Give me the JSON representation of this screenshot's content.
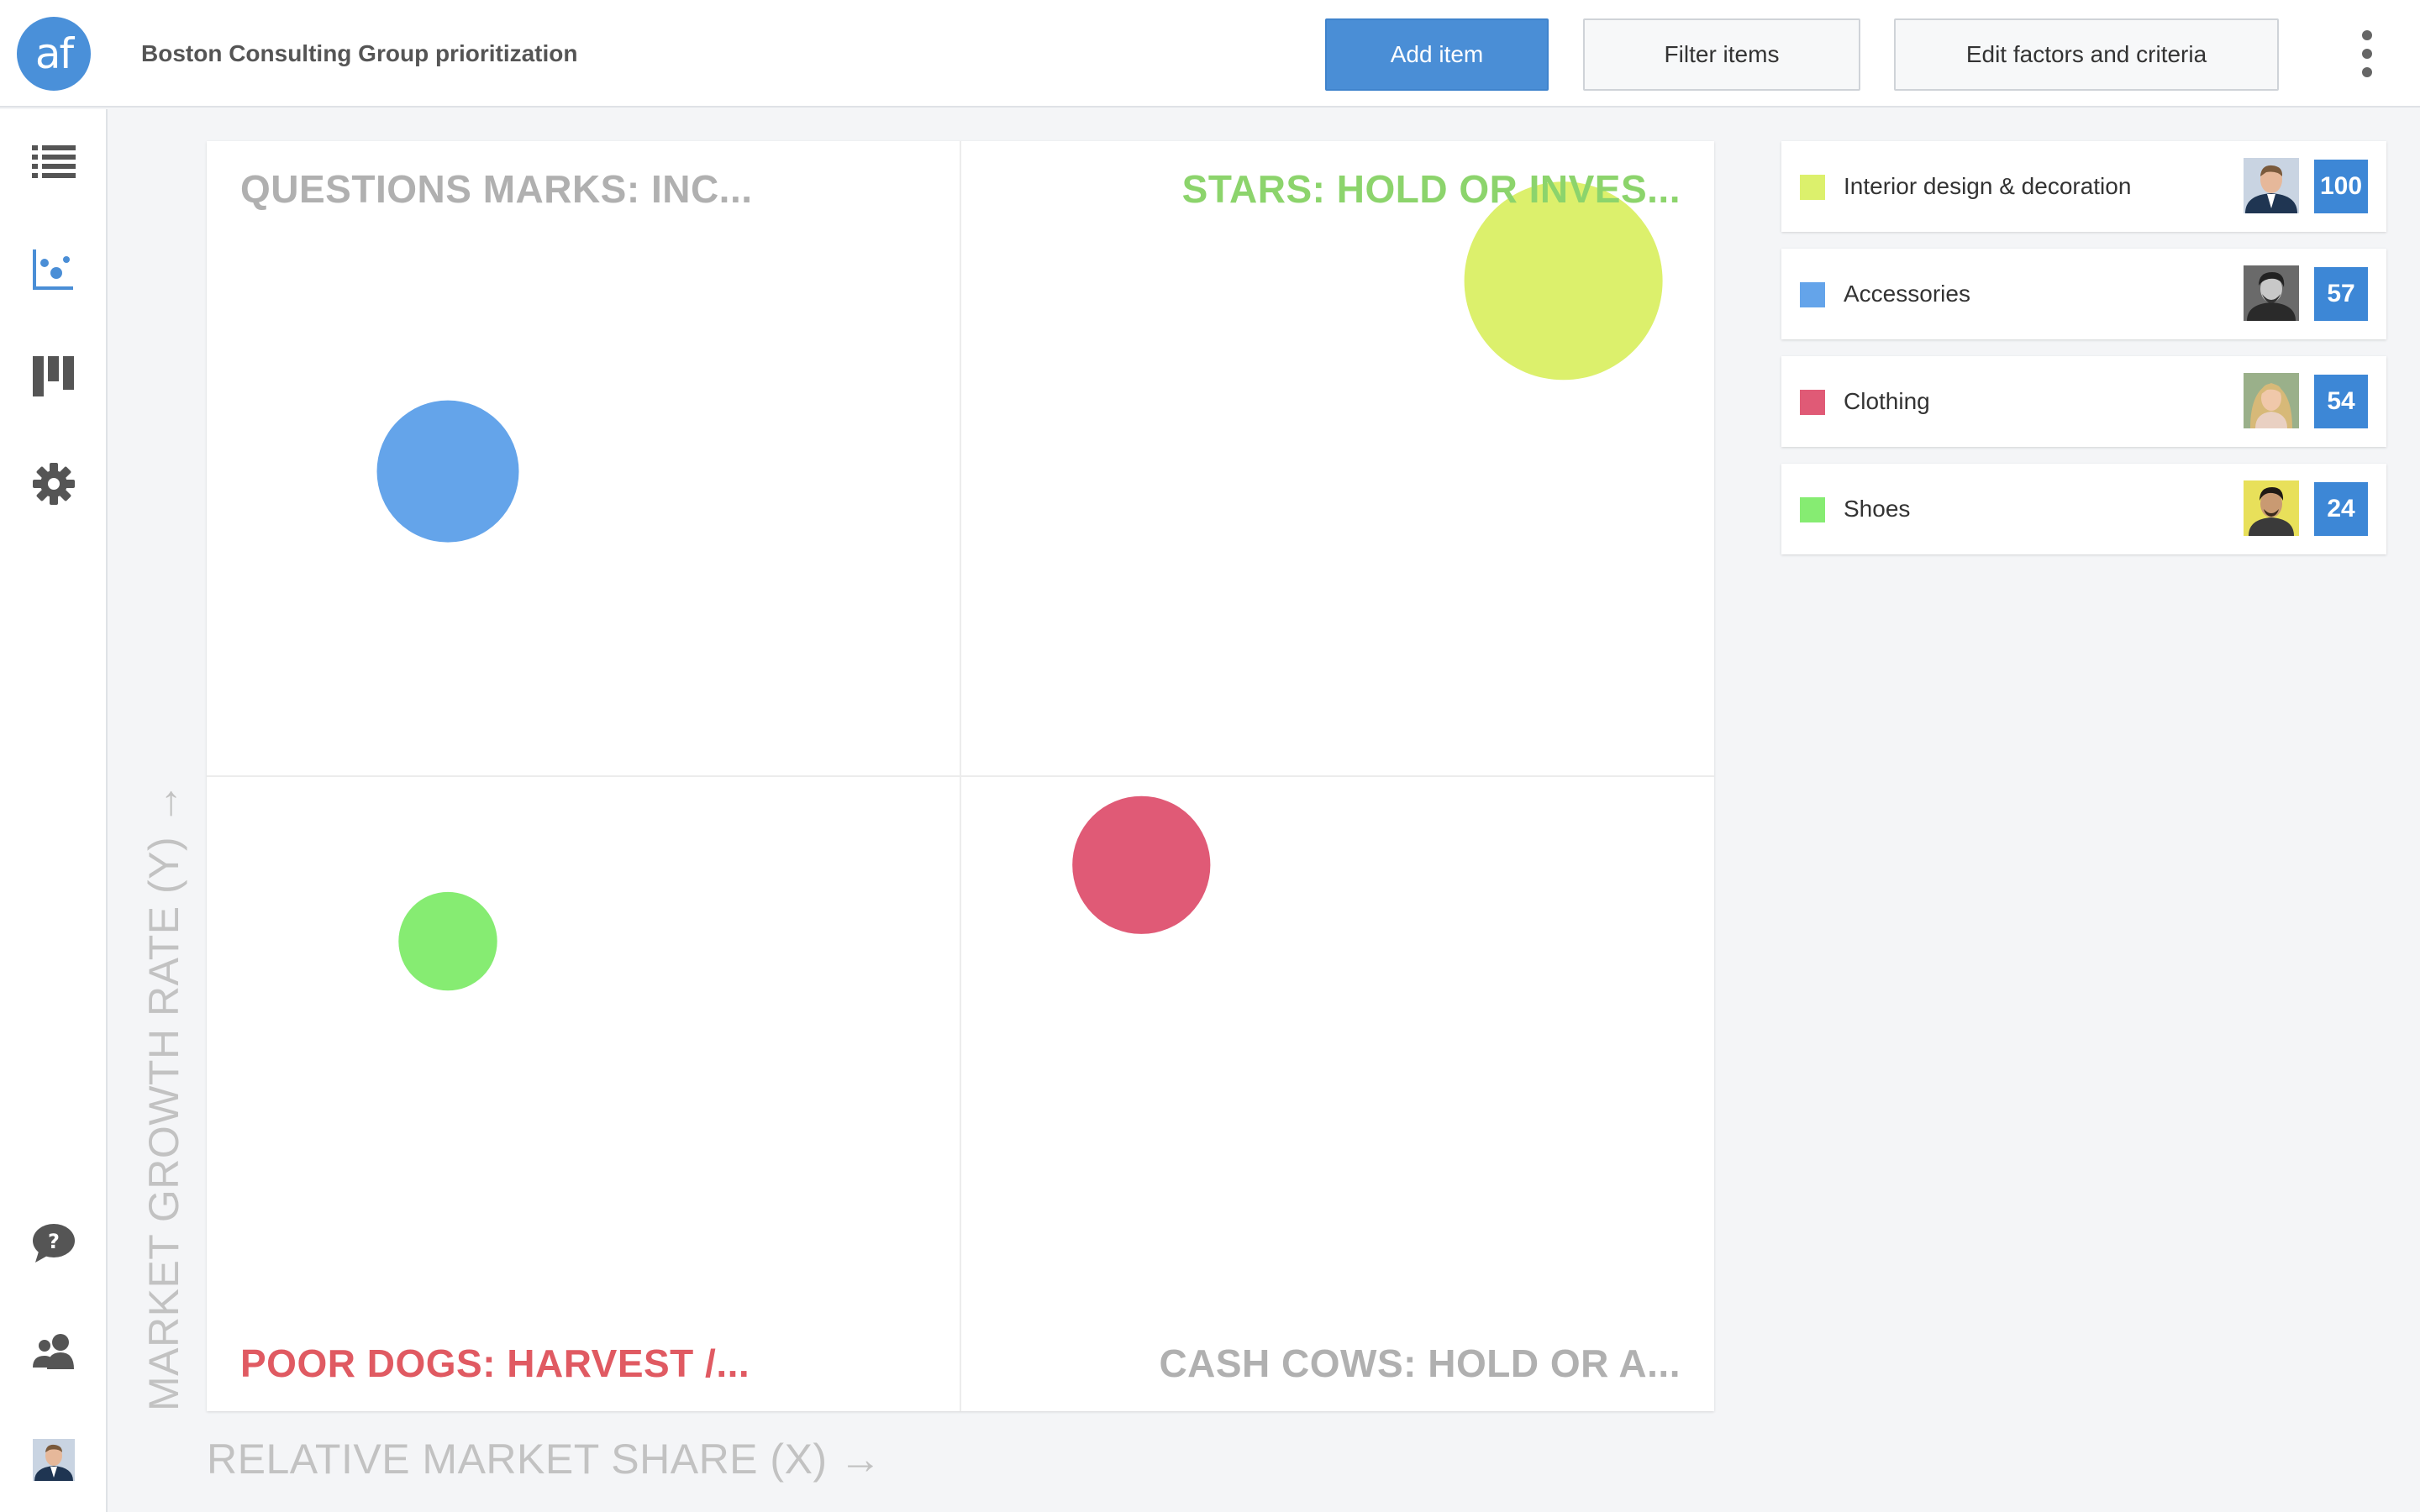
{
  "app": {
    "logo_text": "af",
    "title": "Boston Consulting Group prioritization"
  },
  "toolbar": {
    "add_label": "Add item",
    "filter_label": "Filter items",
    "edit_label": "Edit factors and criteria"
  },
  "sidebar": {
    "items": [
      {
        "name": "list-view",
        "icon": "list-icon",
        "active": false
      },
      {
        "name": "matrix-view",
        "icon": "scatter-chart-icon",
        "active": true
      },
      {
        "name": "board-view",
        "icon": "columns-icon",
        "active": false
      },
      {
        "name": "settings",
        "icon": "gear-icon",
        "active": false
      },
      {
        "name": "help",
        "icon": "help-bubble-icon",
        "active": false
      },
      {
        "name": "users",
        "icon": "users-icon",
        "active": false
      },
      {
        "name": "profile",
        "icon": "avatar-icon",
        "active": false
      }
    ]
  },
  "chart_data": {
    "type": "scatter",
    "xlabel": "RELATIVE MARKET SHARE (X) →",
    "ylabel": "MARKET GROWTH RATE (Y) →",
    "xlim": [
      0,
      100
    ],
    "ylim": [
      0,
      100
    ],
    "quadrants": {
      "top_left": "QUESTIONS MARKS: INC...",
      "top_right": "STARS: HOLD OR INVES...",
      "bottom_left": "POOR DOGS: HARVEST /...",
      "bottom_right": "CASH COWS: HOLD OR A..."
    },
    "points": [
      {
        "name": "Interior design & decoration",
        "x": 90,
        "y": 89,
        "size": 100,
        "color": "#dcf06c"
      },
      {
        "name": "Accessories",
        "x": 16,
        "y": 74,
        "size": 57,
        "color": "#64a4ea"
      },
      {
        "name": "Clothing",
        "x": 62,
        "y": 43,
        "size": 54,
        "color": "#e05a76"
      },
      {
        "name": "Shoes",
        "x": 16,
        "y": 37,
        "size": 24,
        "color": "#86ec72"
      }
    ]
  },
  "items": [
    {
      "label": "Interior design & decoration",
      "score": "100",
      "color": "#dcf06c",
      "avatar": "man-suit"
    },
    {
      "label": "Accessories",
      "score": "57",
      "color": "#64a4ea",
      "avatar": "man-bw"
    },
    {
      "label": "Clothing",
      "score": "54",
      "color": "#e05a76",
      "avatar": "woman-blonde"
    },
    {
      "label": "Shoes",
      "score": "24",
      "color": "#86ec72",
      "avatar": "man-yellow"
    }
  ]
}
